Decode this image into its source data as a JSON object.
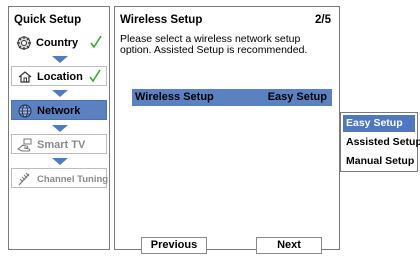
{
  "sidebar": {
    "title": "Quick Setup",
    "items": [
      {
        "label": "Country",
        "icon": "gear-icon",
        "completed": true
      },
      {
        "label": "Location",
        "icon": "house-icon",
        "completed": true
      },
      {
        "label": "Network",
        "icon": "globe-icon",
        "active": true
      },
      {
        "label": "Smart TV",
        "icon": "hand-icon",
        "disabled": true
      },
      {
        "label": "Channel Tuning",
        "icon": "antenna-icon",
        "disabled": true
      }
    ]
  },
  "main": {
    "title": "Wireless Setup",
    "step": "2/5",
    "description": "Please select a wireless network setup option. Assisted Setup is recommended.",
    "setting": {
      "name": "Wireless Setup",
      "value": "Easy Setup"
    },
    "buttons": {
      "previous": "Previous",
      "next": "Next"
    }
  },
  "dropdown": {
    "options": [
      "Easy Setup",
      "Assisted Setup",
      "Manual Setup"
    ],
    "selected": "Easy Setup"
  },
  "colors": {
    "accent": "#5a82c3",
    "selected": "#4f77c2",
    "arrow": "#4a7cc8",
    "check": "#3aa832",
    "disabled_text": "#8a8a8a"
  }
}
